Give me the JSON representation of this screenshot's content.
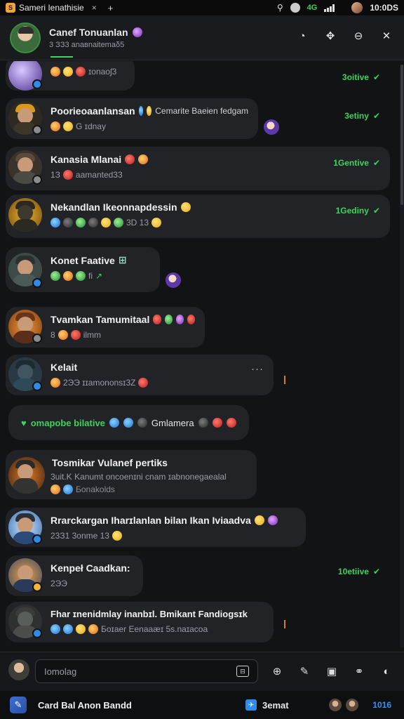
{
  "statusbar": {
    "tab_title": "Sameri Ienathisie",
    "tab_close": "×",
    "tab_plus": "+",
    "signal_label": "4G",
    "time": "10:0DS"
  },
  "header": {
    "title": "Canef Tonuanlan",
    "subtitle": "3 ЗЗ3 anaвnaitemaδ5"
  },
  "messages": [
    {
      "name": "",
      "sub": "ɪonaoʃ3",
      "status": "3oitive"
    },
    {
      "name": "Poorieoaanlansan",
      "name_extra": "Cemarite Baeien fedgam",
      "sub": "G ɪdnay",
      "status": "3etiny"
    },
    {
      "name": "Kanasia Mlanai",
      "sub": "aamanted33",
      "status": "1Gentive"
    },
    {
      "name": "Nekandlan Ikeonnapdessin",
      "sub": "3D 13",
      "status": "1Gediny"
    },
    {
      "name": "Konet Faative",
      "sub": "fi"
    },
    {
      "name": "Tvamkan Tamumitaal",
      "sub": "ilmm"
    },
    {
      "name": "Kelait",
      "sub": "2ЭЭ ɪɪаmononsɪ3Z",
      "more": "···"
    },
    {
      "system_text": "omapobe bilative",
      "system_text2": "Gmlamera"
    },
    {
      "name": "Tosmikar Vulanef pertiks",
      "sub": "3uit.K Kanumt oncoenɪni cnam ɪabnonegaealal",
      "sub2": "Бonakolds"
    },
    {
      "name": "Rrarckargan Iharɪlanlan bilan Ikan Iviaadva",
      "sub": "23З1 3onme 13"
    },
    {
      "name": "Kenpeł Caadkan:",
      "sub": "2ЭЭ",
      "status": "10etiive"
    },
    {
      "name": "Fhar ɪnenidmlay inanbɪl. Bmikant Fandiogsɪk",
      "sub": "Бoɪaer Eenaaæɪ 5s.naɪacoa"
    }
  ],
  "composer": {
    "placeholder": "Iomolag"
  },
  "bottombar": {
    "title": "Card Bal Anon Bandd",
    "mid_label": "3emat",
    "count": "1016"
  }
}
